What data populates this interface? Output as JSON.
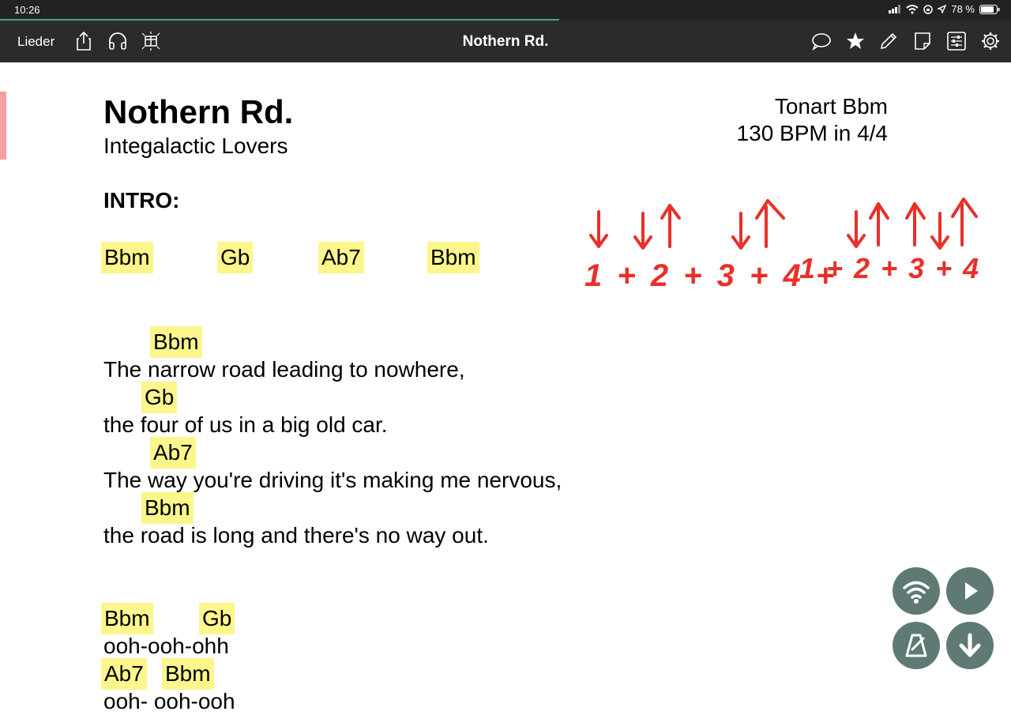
{
  "status": {
    "time": "10:26",
    "battery": "78 %"
  },
  "toolbar": {
    "back_label": "Lieder",
    "title": "Nothern Rd."
  },
  "song": {
    "title": "Nothern Rd.",
    "artist": "Integalactic Lovers",
    "key": "Tonart Bbm",
    "tempo": "130 BPM in 4/4"
  },
  "intro": {
    "label": "INTRO:",
    "chords": [
      "Bbm",
      "Gb",
      "Ab7",
      "Bbm"
    ]
  },
  "verse": {
    "lines": [
      {
        "chord": "Bbm",
        "text": "The narrow road leading to nowhere,"
      },
      {
        "chord": "Gb",
        "text": "the four of us in a big old car."
      },
      {
        "chord": "Ab7",
        "text": "The way you're driving it's making me nervous,"
      },
      {
        "chord": "Bbm",
        "text": "the road is long and there's no way out."
      }
    ]
  },
  "chorus": {
    "chords_line1": [
      "Bbm",
      "Gb"
    ],
    "text_line1": "ooh-ooh-ohh",
    "chords_line2": [
      "Ab7",
      "Bbm"
    ],
    "text_line2": "ooh-  ooh-ooh"
  },
  "annotation": {
    "strum_text_1": "1 + 2 + 3 + 4 +",
    "strum_text_2": "1 + 2 + 3 + 4 +",
    "ink_color": "#e8302a"
  },
  "colors": {
    "chord_highlight": "#fdf68c",
    "toolbar_bg": "#2b2b2b",
    "fab_bg": "#5f7a74"
  }
}
